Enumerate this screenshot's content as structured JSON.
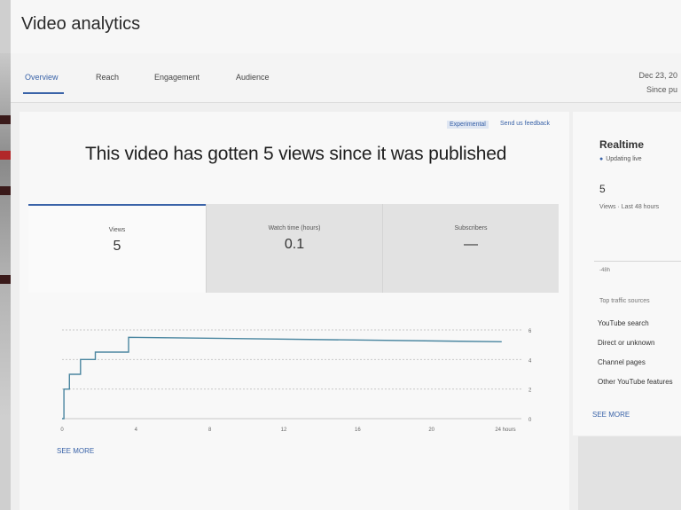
{
  "header": {
    "title": "Video analytics"
  },
  "tabs": [
    {
      "label": "Overview",
      "active": true
    },
    {
      "label": "Reach",
      "active": false
    },
    {
      "label": "Engagement",
      "active": false
    },
    {
      "label": "Audience",
      "active": false
    }
  ],
  "date_range": {
    "date": "Dec 23, 20",
    "label": "Since pu"
  },
  "main": {
    "experimental_badge": "Experimental",
    "feedback_link": "Send us feedback",
    "headline": "This video has gotten 5 views since it was published",
    "see_more": "SEE MORE"
  },
  "metrics": [
    {
      "label": "Views",
      "value": "5"
    },
    {
      "label": "Watch time (hours)",
      "value": "0.1"
    },
    {
      "label": "Subscribers",
      "value": "—"
    }
  ],
  "chart_data": {
    "type": "line",
    "x_ticks": [
      "0",
      "4",
      "8",
      "12",
      "16",
      "20",
      "24 hours"
    ],
    "y_ticks": [
      "0",
      "2",
      "4",
      "6"
    ],
    "ylim": [
      0,
      6
    ],
    "xlim": [
      0,
      24
    ],
    "series": [
      {
        "x": [
          0,
          0.1,
          0.1,
          0.4,
          0.4,
          1.0,
          1.0,
          1.8,
          1.8,
          3.6,
          3.6,
          23.8
        ],
        "y": [
          0,
          0,
          2,
          2,
          3,
          3,
          4,
          4,
          4.5,
          4.5,
          5.5,
          5.2
        ]
      }
    ],
    "colors": {
      "line": "#4a86a0",
      "grid": "#c8c8c8"
    }
  },
  "realtime": {
    "title": "Realtime",
    "status": "Updating live",
    "count": "5",
    "count_label": "Views · Last 48 hours",
    "axis_label": "-48h",
    "traffic_title": "Top traffic sources",
    "sources": [
      "YouTube search",
      "Direct or unknown",
      "Channel pages",
      "Other YouTube features"
    ],
    "see_more": "SEE MORE"
  },
  "colors": {
    "accent": "#3a63a8"
  }
}
